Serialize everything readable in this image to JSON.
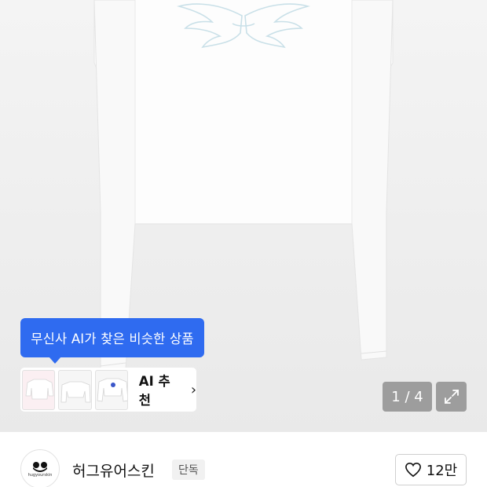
{
  "gallery": {
    "tooltip_text": "무신사 AI가 찾은 비슷한 상품",
    "ai_recommend_label": "AI 추천",
    "chevron_glyph": "›",
    "counter": "1 / 4",
    "thumbnails": [
      "thumb-pink-top",
      "thumb-white-crop",
      "thumb-white-logo-top"
    ]
  },
  "brand": {
    "name": "허그유어스킨",
    "badge": "단독",
    "logo_caption": "hugyourskin",
    "like_count": "12만"
  },
  "colors": {
    "accent": "#2f6bf0",
    "overlay": "#6e6e6e"
  },
  "icons": {
    "expand": "expand-arrows-icon",
    "like": "heart-outline-icon",
    "chevron": "chevron-right-icon"
  }
}
